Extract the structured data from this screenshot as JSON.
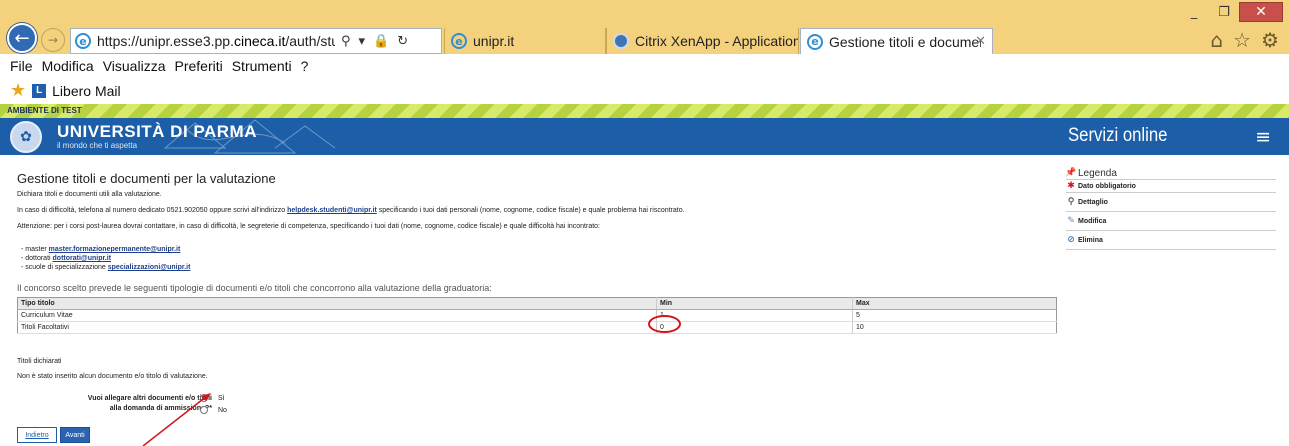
{
  "browser": {
    "url_prefix": "https://unipr.esse3.pp.",
    "url_domain": "cineca.it",
    "url_suffix": "/auth/studente/A",
    "tabs": [
      {
        "label": "unipr.it"
      },
      {
        "label": "Citrix XenApp - Applications"
      },
      {
        "label": "Gestione titoli e documenti ..."
      }
    ],
    "menu": [
      "File",
      "Modifica",
      "Visualizza",
      "Preferiti",
      "Strumenti",
      "?"
    ],
    "favorites": [
      {
        "label": "Libero Mail"
      }
    ],
    "window_controls": {
      "minimize": "_",
      "maximize": "❐",
      "close": "✕"
    }
  },
  "site": {
    "test_banner": "AMBIENTE DI TEST",
    "university_name": "UNIVERSITÀ DI PARMA",
    "tagline": "il mondo che ti aspetta",
    "services": "Servizi online",
    "colors": {
      "header": "#1c5fa8",
      "test_strip": "#b7d23f",
      "accent_link": "#1d3f8a",
      "highlight": "#d4141c"
    }
  },
  "page": {
    "title": "Gestione titoli e documenti per la valutazione",
    "intro": "Dichiara titoli e documenti utili alla valutazione.",
    "help_before": "In caso di difficoltà, telefona al numero dedicato 0521.902050 oppure scrivi all'indirizzo ",
    "help_email": "helpdesk.studenti@unipr.it",
    "help_after": " specificando i tuoi dati personali (nome, cognome, codice fiscale) e quale problema hai riscontrato.",
    "attention": "Attenzione: per i corsi post-laurea dovrai contattare, in caso di difficoltà, le segreterie di competenza, specificando i tuoi dati (nome, cognome, codice fiscale) e quale difficoltà hai incontrato:",
    "contacts": [
      {
        "label": "- master ",
        "email": "master.formazionepermanente@unipr.it"
      },
      {
        "label": "- dottorati ",
        "email": "dottorati@unipr.it"
      },
      {
        "label": "- scuole di specializzazione ",
        "email": "specializzazioni@unipr.it"
      }
    ],
    "table_intro": "Il concorso scelto prevede le seguenti tipologie di documenti e/o titoli che concorrono alla valutazione della graduatoria:",
    "table": {
      "headers": [
        "Tipo titolo",
        "Min",
        "Max"
      ],
      "rows": [
        [
          "Curriculum Vitae",
          "1",
          "5"
        ],
        [
          "Titoli Facoltativi",
          "0",
          "10"
        ]
      ]
    },
    "declared_heading": "Titoli dichiarati",
    "declared_empty": "Non è stato inserito alcun documento e/o titolo di valutazione.",
    "question": "Vuoi allegare altri documenti e/o titoli alla domanda di ammissione?*",
    "options": [
      {
        "label": "Sì",
        "selected": true
      },
      {
        "label": "No",
        "selected": false
      }
    ],
    "back_button": "Indietro",
    "next_button": "Avanti"
  },
  "legend": {
    "title": "Legenda",
    "items": [
      {
        "label": "Dato obbligatorio",
        "icon": "required-star-icon"
      },
      {
        "label": "Dettaglio",
        "icon": "magnifier-icon"
      },
      {
        "label": "Modifica",
        "icon": "edit-icon"
      },
      {
        "label": "Elimina",
        "icon": "delete-icon"
      }
    ]
  }
}
